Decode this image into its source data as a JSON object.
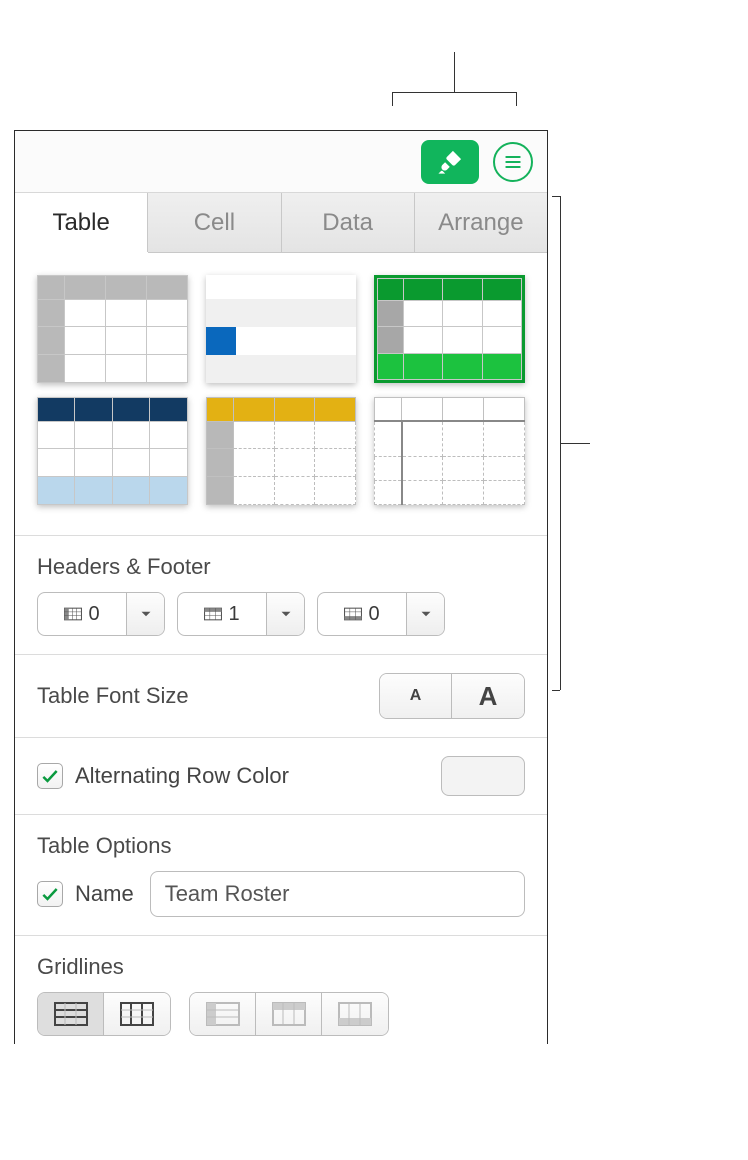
{
  "tabs": [
    "Table",
    "Cell",
    "Data",
    "Arrange"
  ],
  "active_tab_index": 0,
  "headers_footer": {
    "title": "Headers & Footer",
    "header_columns": "0",
    "header_rows": "1",
    "footer_rows": "0"
  },
  "table_font_size": {
    "title": "Table Font Size",
    "small_label": "A",
    "big_label": "A"
  },
  "alternating": {
    "label": "Alternating Row Color",
    "checked": true
  },
  "table_options": {
    "title": "Table Options",
    "name_label": "Name",
    "name_checked": true,
    "name_value": "Team Roster"
  },
  "gridlines": {
    "title": "Gridlines"
  }
}
